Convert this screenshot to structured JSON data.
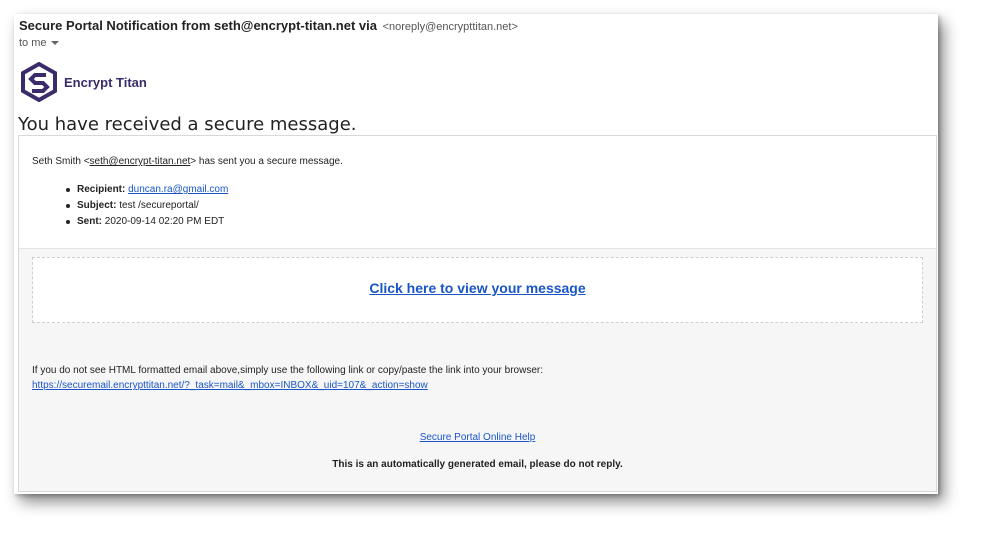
{
  "email": {
    "subject": "Secure Portal Notification from seth@encrypt-titan.net via",
    "sender_address": "<noreply@encrypttitan.net>",
    "to_label": "to me"
  },
  "logo": {
    "icon": "encrypt-titan-logo-icon",
    "text": "Encrypt Titan",
    "color": "#3b2b6b"
  },
  "heading": "You have received a secure message.",
  "intro": {
    "name": "Seth Smith <",
    "email": "seth@encrypt-titan.net",
    "suffix": "> has sent you a secure message."
  },
  "details": [
    {
      "label": "Recipient:",
      "value": "duncan.ra@gmail.com",
      "is_link": true
    },
    {
      "label": "Subject:",
      "value": "test /secureportal/",
      "is_link": false
    },
    {
      "label": "Sent:",
      "value": "2020-09-14 02:20 PM EDT",
      "is_link": false
    }
  ],
  "cta_label": "Click here to view your message",
  "fallback": {
    "text": "If you do not see HTML formatted email above,simply use the following link or copy/paste the link into your browser:",
    "url": "https://securemail.encrypttitan.net/?_task=mail&_mbox=INBOX&_uid=107&_action=show"
  },
  "help_link": "Secure Portal Online Help",
  "noreply_note": "This is an automatically generated email, please do not reply.",
  "colors": {
    "link": "#1a55c8",
    "brand": "#3b2b6b"
  }
}
